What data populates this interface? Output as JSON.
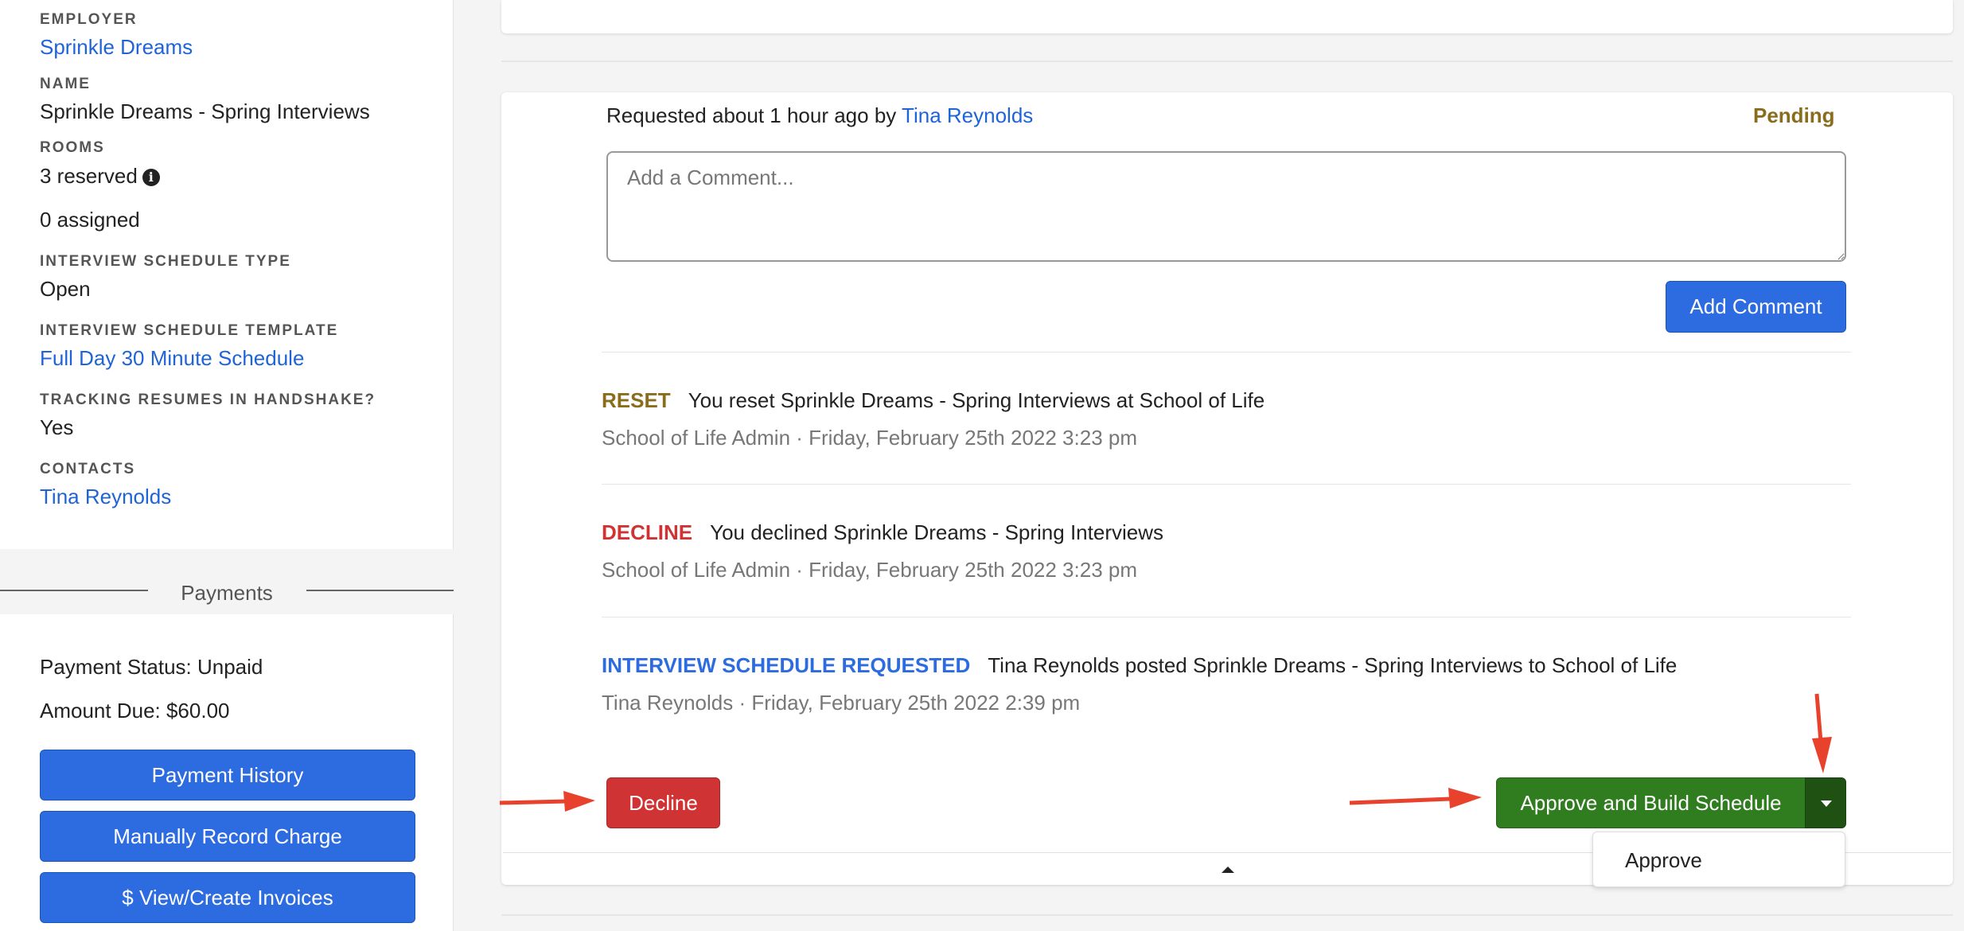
{
  "colors": {
    "link": "#1f64d6",
    "pending": "#8a6d1c",
    "reset": "#8a6d1c",
    "decline": "#cf3333",
    "requested_tag": "#2c6be0",
    "approve": "#2f7d1f",
    "primary_button": "#2c6be0",
    "annotation_arrow": "#e8412c"
  },
  "sidebar": {
    "employer_label": "EMPLOYER",
    "employer_value": "Sprinkle Dreams",
    "name_label": "NAME",
    "name_value": "Sprinkle Dreams - Spring Interviews",
    "rooms_label": "ROOMS",
    "rooms_reserved": "3 reserved",
    "rooms_info_icon": "info-icon",
    "rooms_assigned": "0 assigned",
    "schedule_type_label": "INTERVIEW SCHEDULE TYPE",
    "schedule_type_value": "Open",
    "schedule_template_label": "INTERVIEW SCHEDULE TEMPLATE",
    "schedule_template_value": "Full Day 30 Minute Schedule",
    "tracking_label": "TRACKING RESUMES IN HANDSHAKE?",
    "tracking_value": "Yes",
    "contacts_label": "CONTACTS",
    "contacts_value": "Tina Reynolds"
  },
  "payments": {
    "title": "Payments",
    "status": "Payment Status: Unpaid",
    "amount_due": "Amount Due: $60.00",
    "history_button": "Payment History",
    "record_charge_button": "Manually Record Charge",
    "invoices_button": "$ View/Create Invoices"
  },
  "request": {
    "requested_text": "Requested about 1 hour ago by ",
    "requested_by": "Tina Reynolds",
    "status": "Pending",
    "comment_placeholder": "Add a Comment...",
    "comment_value": "",
    "add_comment_button": "Add Comment"
  },
  "activity": [
    {
      "tag": "RESET",
      "text": "You reset Sprinkle Dreams - Spring Interviews at School of Life",
      "meta": "School of Life Admin · Friday, February 25th 2022 3:23 pm"
    },
    {
      "tag": "DECLINE",
      "text": "You declined Sprinkle Dreams - Spring Interviews",
      "meta": "School of Life Admin · Friday, February 25th 2022 3:23 pm"
    },
    {
      "tag": "INTERVIEW SCHEDULE REQUESTED",
      "text": "Tina Reynolds posted Sprinkle Dreams - Spring Interviews to School of Life",
      "meta": "Tina Reynolds · Friday, February 25th 2022 2:39 pm"
    }
  ],
  "actions": {
    "decline_button": "Decline",
    "approve_build_button": "Approve and Build Schedule",
    "caret_icon": "caret-down-icon",
    "dropdown_items": [
      "Approve"
    ],
    "collapse_icon": "caret-up-icon"
  }
}
